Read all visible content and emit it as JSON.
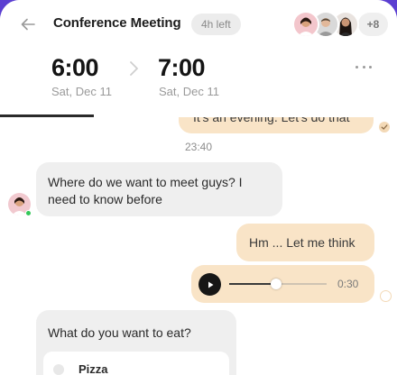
{
  "header": {
    "title": "Conference Meeting",
    "time_left": "4h left",
    "participants_more": "+8",
    "start_time": "6:00",
    "start_date": "Sat, Dec 11",
    "end_time": "7:00",
    "end_date": "Sat, Dec 11",
    "progress": 0.236
  },
  "messages": {
    "m1_text": "It's an evening. Let's do that",
    "timestamp": "23:40",
    "m2_text": "Where do we want to meet guys? I need to know before",
    "m3_text": "Hm ... Let me think",
    "voice_duration": "0:30",
    "voice_progress": 0.48
  },
  "poll": {
    "question": "What do you want to eat?",
    "options": [
      "Pizza"
    ]
  },
  "colors": {
    "background_accent": "#5b3fd1",
    "outgoing_bubble": "#f9e4c7",
    "incoming_bubble": "#efefef",
    "online": "#34c759"
  }
}
